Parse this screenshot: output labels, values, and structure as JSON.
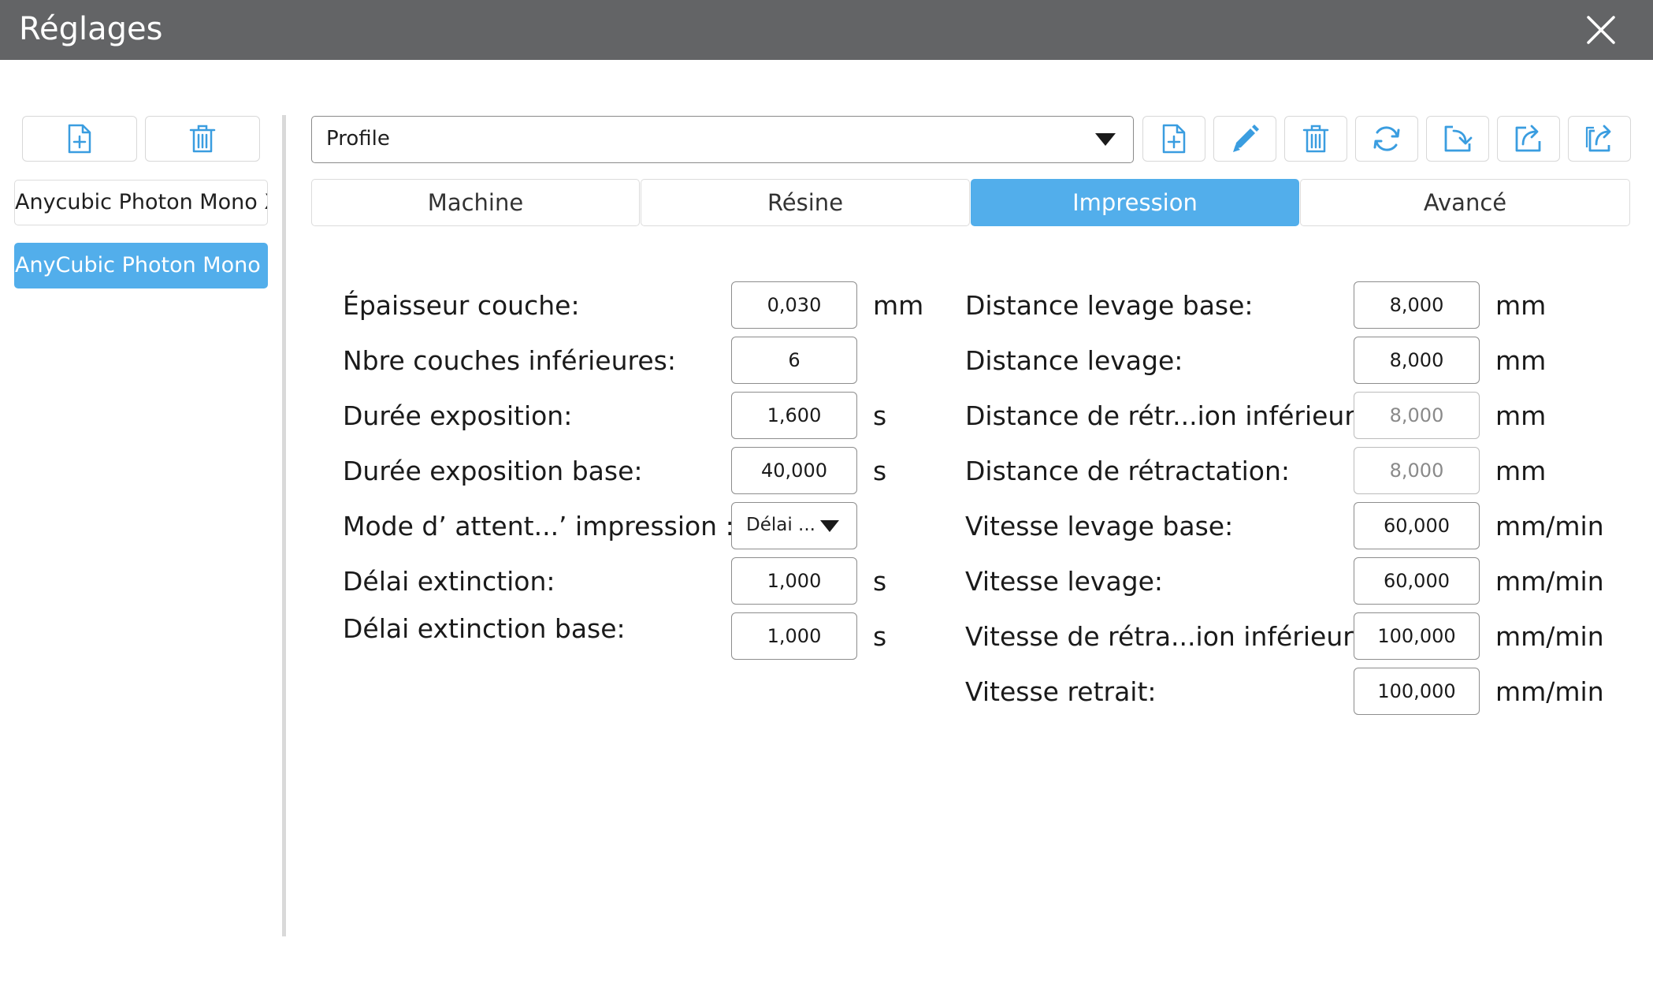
{
  "window": {
    "title": "Réglages",
    "close_icon": "close-icon"
  },
  "sidebar": {
    "actions": [
      {
        "icon": "new-file-icon"
      },
      {
        "icon": "trash-icon"
      }
    ],
    "profiles": [
      {
        "label": "Anycubic Photon Mono X",
        "selected": false
      },
      {
        "label": "AnyCubic Photon Mono X",
        "selected": true
      }
    ]
  },
  "toolbar": {
    "profile_select": {
      "value": "Profile"
    },
    "buttons": [
      {
        "icon": "new-file-icon"
      },
      {
        "icon": "pencil-icon"
      },
      {
        "icon": "trash-icon"
      },
      {
        "icon": "refresh-icon"
      },
      {
        "icon": "import-icon"
      },
      {
        "icon": "export-icon"
      },
      {
        "icon": "export-all-icon"
      }
    ]
  },
  "tabs": [
    {
      "label": "Machine",
      "active": false
    },
    {
      "label": "Résine",
      "active": false
    },
    {
      "label": "Impression",
      "active": true
    },
    {
      "label": "Avancé",
      "active": false
    }
  ],
  "left_fields": [
    {
      "label": "Épaisseur couche:",
      "value": "0,030",
      "unit": "mm"
    },
    {
      "label": "Nbre couches inférieures:",
      "value": "6",
      "unit": ""
    },
    {
      "label": "Durée exposition:",
      "value": "1,600",
      "unit": "s"
    },
    {
      "label": "Durée exposition base:",
      "value": "40,000",
      "unit": "s"
    },
    {
      "label": "Mode d’   attent...’   impression :",
      "value": "Délai ...",
      "unit": ""
    },
    {
      "label": "Délai extinction:",
      "value": "1,000",
      "unit": "s"
    },
    {
      "label": "Délai extinction base:",
      "value": "1,000",
      "unit": "s"
    }
  ],
  "right_fields": [
    {
      "label": "Distance levage base:",
      "value": "8,000",
      "unit": "mm",
      "disabled": false
    },
    {
      "label": "Distance levage:",
      "value": "8,000",
      "unit": "mm",
      "disabled": false
    },
    {
      "label": "Distance de rétr...ion inférieure :",
      "value": "8,000",
      "unit": "mm",
      "disabled": true
    },
    {
      "label": "Distance de rétractation:",
      "value": "8,000",
      "unit": "mm",
      "disabled": true
    },
    {
      "label": "Vitesse levage base:",
      "value": "60,000",
      "unit": "mm/min",
      "disabled": false
    },
    {
      "label": "Vitesse levage:",
      "value": "60,000",
      "unit": "mm/min",
      "disabled": false
    },
    {
      "label": "Vitesse de rétra...ion inférieure :",
      "value": "100,000",
      "unit": "mm/min",
      "disabled": false
    },
    {
      "label": "Vitesse retrait:",
      "value": "100,000",
      "unit": "mm/min",
      "disabled": false
    }
  ],
  "colors": {
    "accent": "#52aeeb",
    "titlebar": "#636466"
  }
}
